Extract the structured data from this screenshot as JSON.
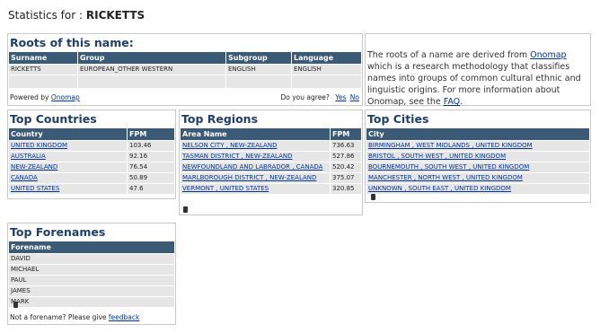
{
  "header": {
    "prefix": "Statistics for :",
    "surname": "RICKETTS"
  },
  "roots": {
    "title": "Roots of this name:",
    "columns": [
      "Surname",
      "Group",
      "Subgroup",
      "Language"
    ],
    "row": [
      "RICKETTS",
      "EUROPEAN_OTHER WESTERN",
      "ENGLISH",
      "ENGLISH"
    ],
    "powered_prefix": "Powered by",
    "powered_link": "Onomap",
    "agree_prompt": "Do you agree?",
    "yes": "Yes",
    "no": "No"
  },
  "info": {
    "text1": "The roots of a name are derived from",
    "link1": "Onomap",
    "text2": "which is a research methodology that classifies names into groups of common cultural ethnic and linguistic origins. For more information about Onomap, see the",
    "link2": "FAQ",
    "text3": "."
  },
  "countries": {
    "title": "Top Countries",
    "columns": [
      "Country",
      "FPM"
    ],
    "rows": [
      [
        "UNITED KINGDOM",
        "103.46"
      ],
      [
        "AUSTRALIA",
        "92.16"
      ],
      [
        "NEW-ZEALAND",
        "76.54"
      ],
      [
        "CANADA",
        "50.89"
      ],
      [
        "UNITED STATES",
        "47.6"
      ]
    ]
  },
  "regions": {
    "title": "Top Regions",
    "columns": [
      "Area Name",
      "FPM"
    ],
    "rows": [
      [
        "NELSON CITY , NEW-ZEALAND",
        "736.63"
      ],
      [
        "TASMAN DISTRICT , NEW-ZEALAND",
        "527.86"
      ],
      [
        "NEWFOUNDLAND AND LABRADOR , CANADA",
        "520.42"
      ],
      [
        "MARLBOROUGH DISTRICT , NEW-ZEALAND",
        "375.07"
      ],
      [
        "VERMONT , UNITED STATES",
        "320.85"
      ]
    ]
  },
  "cities": {
    "title": "Top Cities",
    "columns": [
      "City"
    ],
    "rows": [
      "BIRMINGHAM , WEST MIDLANDS , UNITED KINGDOM",
      "BRISTOL , SOUTH WEST , UNITED KINGDOM",
      "BOURNEMOUTH , SOUTH WEST , UNITED KINGDOM",
      "MANCHESTER , NORTH WEST , UNITED KINGDOM",
      "UNKNOWN , SOUTH EAST , UNITED KINGDOM"
    ]
  },
  "forenames": {
    "title": "Top Forenames",
    "columns": [
      "Forename"
    ],
    "rows": [
      "DAVID",
      "MICHAEL",
      "PAUL",
      "JAMES",
      "MARK"
    ],
    "feedback_prefix": "Not a forename? Please give",
    "feedback_link": "feedback"
  }
}
